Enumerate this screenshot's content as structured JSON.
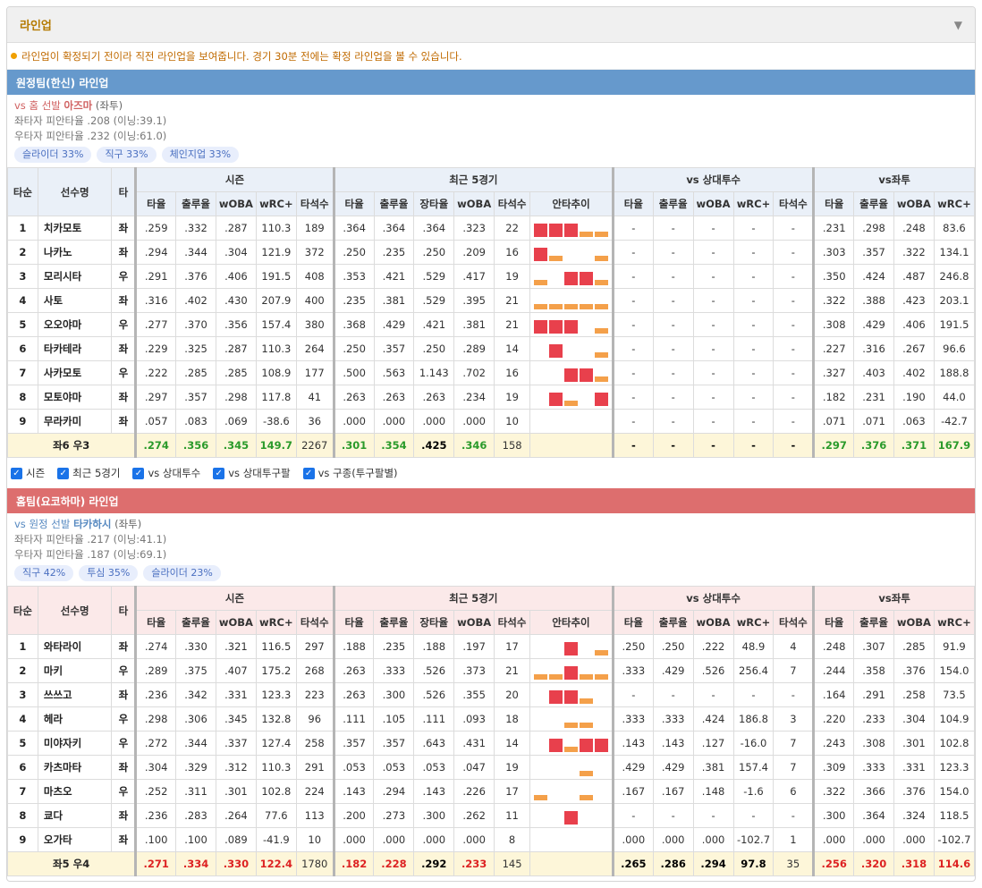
{
  "panel": {
    "title": "라인업",
    "toggle_icon": "▼"
  },
  "notice": "라인업이 확정되기 전이라 직전 라인업을 보여줍니다. 경기 30분 전에는 확정 라인업을 볼 수 있습니다.",
  "headers": {
    "order": "타순",
    "player": "선수명",
    "hand": "타",
    "groups": [
      "시즌",
      "최근 5경기",
      "vs 상대투수",
      "vs좌투"
    ],
    "season": [
      "타율",
      "출루율",
      "wOBA",
      "wRC+",
      "타석수"
    ],
    "recent": [
      "타율",
      "출루율",
      "장타율",
      "wOBA",
      "타석수",
      "안타추이"
    ],
    "vs_pitcher": [
      "타율",
      "출루율",
      "wOBA",
      "wRC+",
      "타석수"
    ],
    "vs_hand": [
      "타율",
      "출루율",
      "wOBA",
      "wRC+"
    ]
  },
  "away": {
    "bar_title": "원정팀(한신) 라인업",
    "pitcher_prefix": "vs 홈 선발 ",
    "pitcher_name": "아즈마",
    "pitcher_hand": " (좌투)",
    "line1": "좌타자 피안타율 .208 (이닝:39.1)",
    "line2": "우타자 피안타율 .232 (이닝:61.0)",
    "chips": [
      "슬라이더 33%",
      "직구 33%",
      "체인지업 33%"
    ],
    "rows": [
      {
        "order": "1",
        "name": "치카모토",
        "hand": "좌",
        "s": [
          ".259",
          ".332",
          ".287",
          "110.3",
          "189"
        ],
        "r": [
          ".364",
          ".364",
          ".364",
          ".323",
          "22"
        ],
        "trend": [
          "hi",
          "hi",
          "hi",
          "lo",
          "lo"
        ],
        "p": [
          "-",
          "-",
          "-",
          "-",
          "-"
        ],
        "h": [
          ".231",
          ".298",
          ".248",
          "83.6"
        ]
      },
      {
        "order": "2",
        "name": "나카노",
        "hand": "좌",
        "s": [
          ".294",
          ".344",
          ".304",
          "121.9",
          "372"
        ],
        "r": [
          ".250",
          ".235",
          ".250",
          ".209",
          "16"
        ],
        "trend": [
          "hi",
          "lo",
          "none",
          "none",
          "lo"
        ],
        "p": [
          "-",
          "-",
          "-",
          "-",
          "-"
        ],
        "h": [
          ".303",
          ".357",
          ".322",
          "134.1"
        ]
      },
      {
        "order": "3",
        "name": "모리시타",
        "hand": "우",
        "s": [
          ".291",
          ".376",
          ".406",
          "191.5",
          "408"
        ],
        "r": [
          ".353",
          ".421",
          ".529",
          ".417",
          "19"
        ],
        "trend": [
          "lo",
          "none",
          "hi",
          "hi",
          "lo"
        ],
        "p": [
          "-",
          "-",
          "-",
          "-",
          "-"
        ],
        "h": [
          ".350",
          ".424",
          ".487",
          "246.8"
        ]
      },
      {
        "order": "4",
        "name": "사토",
        "hand": "좌",
        "s": [
          ".316",
          ".402",
          ".430",
          "207.9",
          "400"
        ],
        "r": [
          ".235",
          ".381",
          ".529",
          ".395",
          "21"
        ],
        "trend": [
          "lo",
          "lo",
          "lo",
          "lo",
          "lo"
        ],
        "p": [
          "-",
          "-",
          "-",
          "-",
          "-"
        ],
        "h": [
          ".322",
          ".388",
          ".423",
          "203.1"
        ]
      },
      {
        "order": "5",
        "name": "오오야마",
        "hand": "우",
        "s": [
          ".277",
          ".370",
          ".356",
          "157.4",
          "380"
        ],
        "r": [
          ".368",
          ".429",
          ".421",
          ".381",
          "21"
        ],
        "trend": [
          "hi",
          "hi",
          "hi",
          "none",
          "lo"
        ],
        "p": [
          "-",
          "-",
          "-",
          "-",
          "-"
        ],
        "h": [
          ".308",
          ".429",
          ".406",
          "191.5"
        ]
      },
      {
        "order": "6",
        "name": "타카테라",
        "hand": "좌",
        "s": [
          ".229",
          ".325",
          ".287",
          "110.3",
          "264"
        ],
        "r": [
          ".250",
          ".357",
          ".250",
          ".289",
          "14"
        ],
        "trend": [
          "none",
          "hi",
          "none",
          "none",
          "lo"
        ],
        "p": [
          "-",
          "-",
          "-",
          "-",
          "-"
        ],
        "h": [
          ".227",
          ".316",
          ".267",
          "96.6"
        ]
      },
      {
        "order": "7",
        "name": "사카모토",
        "hand": "우",
        "s": [
          ".222",
          ".285",
          ".285",
          "108.9",
          "177"
        ],
        "r": [
          ".500",
          ".563",
          "1.143",
          ".702",
          "16"
        ],
        "trend": [
          "none",
          "none",
          "hi",
          "hi",
          "lo"
        ],
        "p": [
          "-",
          "-",
          "-",
          "-",
          "-"
        ],
        "h": [
          ".327",
          ".403",
          ".402",
          "188.8"
        ]
      },
      {
        "order": "8",
        "name": "모토야마",
        "hand": "좌",
        "s": [
          ".297",
          ".357",
          ".298",
          "117.8",
          "41"
        ],
        "r": [
          ".263",
          ".263",
          ".263",
          ".234",
          "19"
        ],
        "trend": [
          "none",
          "hi",
          "lo",
          "none",
          "hi"
        ],
        "p": [
          "-",
          "-",
          "-",
          "-",
          "-"
        ],
        "h": [
          ".182",
          ".231",
          ".190",
          "44.0"
        ]
      },
      {
        "order": "9",
        "name": "무라카미",
        "hand": "좌",
        "s": [
          ".057",
          ".083",
          ".069",
          "-38.6",
          "36"
        ],
        "r": [
          ".000",
          ".000",
          ".000",
          ".000",
          "10"
        ],
        "trend": [
          "none",
          "none",
          "none",
          "none",
          "none"
        ],
        "p": [
          "-",
          "-",
          "-",
          "-",
          "-"
        ],
        "h": [
          ".071",
          ".071",
          ".063",
          "-42.7"
        ]
      }
    ],
    "total": {
      "label": "좌6 우3",
      "s": [
        ".274",
        ".356",
        ".345",
        "149.7",
        "2267"
      ],
      "r": [
        ".301",
        ".354",
        ".425",
        ".346",
        "158"
      ],
      "p": [
        "-",
        "-",
        "-",
        "-",
        "-"
      ],
      "h": [
        ".297",
        ".376",
        ".371",
        "167.9"
      ]
    }
  },
  "checks": [
    "시즌",
    "최근 5경기",
    "vs 상대투수",
    "vs 상대투구팔",
    "vs 구종(투구팔별)"
  ],
  "home": {
    "bar_title": "홈팀(요코하마) 라인업",
    "pitcher_prefix": "vs 원정 선발 ",
    "pitcher_name": "타카하시",
    "pitcher_hand": " (좌투)",
    "line1": "좌타자 피안타율 .217 (이닝:41.1)",
    "line2": "우타자 피안타율 .187 (이닝:69.1)",
    "chips": [
      "직구 42%",
      "투심 35%",
      "슬라이더 23%"
    ],
    "rows": [
      {
        "order": "1",
        "name": "와타라이",
        "hand": "좌",
        "s": [
          ".274",
          ".330",
          ".321",
          "116.5",
          "297"
        ],
        "r": [
          ".188",
          ".235",
          ".188",
          ".197",
          "17"
        ],
        "trend": [
          "none",
          "none",
          "hi",
          "none",
          "lo"
        ],
        "p": [
          ".250",
          ".250",
          ".222",
          "48.9",
          "4"
        ],
        "h": [
          ".248",
          ".307",
          ".285",
          "91.9"
        ]
      },
      {
        "order": "2",
        "name": "마키",
        "hand": "우",
        "s": [
          ".289",
          ".375",
          ".407",
          "175.2",
          "268"
        ],
        "r": [
          ".263",
          ".333",
          ".526",
          ".373",
          "21"
        ],
        "trend": [
          "lo",
          "lo",
          "hi",
          "lo",
          "lo"
        ],
        "p": [
          ".333",
          ".429",
          ".526",
          "256.4",
          "7"
        ],
        "h": [
          ".244",
          ".358",
          ".376",
          "154.0"
        ]
      },
      {
        "order": "3",
        "name": "쓰쓰고",
        "hand": "좌",
        "s": [
          ".236",
          ".342",
          ".331",
          "123.3",
          "223"
        ],
        "r": [
          ".263",
          ".300",
          ".526",
          ".355",
          "20"
        ],
        "trend": [
          "none",
          "hi",
          "hi",
          "lo",
          "none"
        ],
        "p": [
          "-",
          "-",
          "-",
          "-",
          "-"
        ],
        "h": [
          ".164",
          ".291",
          ".258",
          "73.5"
        ]
      },
      {
        "order": "4",
        "name": "헤라",
        "hand": "우",
        "s": [
          ".298",
          ".306",
          ".345",
          "132.8",
          "96"
        ],
        "r": [
          ".111",
          ".105",
          ".111",
          ".093",
          "18"
        ],
        "trend": [
          "none",
          "none",
          "lo",
          "lo",
          "none"
        ],
        "p": [
          ".333",
          ".333",
          ".424",
          "186.8",
          "3"
        ],
        "h": [
          ".220",
          ".233",
          ".304",
          "104.9"
        ]
      },
      {
        "order": "5",
        "name": "미야자키",
        "hand": "우",
        "s": [
          ".272",
          ".344",
          ".337",
          "127.4",
          "258"
        ],
        "r": [
          ".357",
          ".357",
          ".643",
          ".431",
          "14"
        ],
        "trend": [
          "none",
          "hi",
          "lo",
          "hi",
          "hi"
        ],
        "p": [
          ".143",
          ".143",
          ".127",
          "-16.0",
          "7"
        ],
        "h": [
          ".243",
          ".308",
          ".301",
          "102.8"
        ]
      },
      {
        "order": "6",
        "name": "카츠마타",
        "hand": "좌",
        "s": [
          ".304",
          ".329",
          ".312",
          "110.3",
          "291"
        ],
        "r": [
          ".053",
          ".053",
          ".053",
          ".047",
          "19"
        ],
        "trend": [
          "none",
          "none",
          "none",
          "lo",
          "none"
        ],
        "p": [
          ".429",
          ".429",
          ".381",
          "157.4",
          "7"
        ],
        "h": [
          ".309",
          ".333",
          ".331",
          "123.3"
        ]
      },
      {
        "order": "7",
        "name": "마츠오",
        "hand": "우",
        "s": [
          ".252",
          ".311",
          ".301",
          "102.8",
          "224"
        ],
        "r": [
          ".143",
          ".294",
          ".143",
          ".226",
          "17"
        ],
        "trend": [
          "lo",
          "none",
          "none",
          "lo",
          "none"
        ],
        "p": [
          ".167",
          ".167",
          ".148",
          "-1.6",
          "6"
        ],
        "h": [
          ".322",
          ".366",
          ".376",
          "154.0"
        ]
      },
      {
        "order": "8",
        "name": "쿄다",
        "hand": "좌",
        "s": [
          ".236",
          ".283",
          ".264",
          "77.6",
          "113"
        ],
        "r": [
          ".200",
          ".273",
          ".300",
          ".262",
          "11"
        ],
        "trend": [
          "none",
          "none",
          "hi",
          "none",
          "none"
        ],
        "p": [
          "-",
          "-",
          "-",
          "-",
          "-"
        ],
        "h": [
          ".300",
          ".364",
          ".324",
          "118.5"
        ]
      },
      {
        "order": "9",
        "name": "오가타",
        "hand": "좌",
        "s": [
          ".100",
          ".100",
          ".089",
          "-41.9",
          "10"
        ],
        "r": [
          ".000",
          ".000",
          ".000",
          ".000",
          "8"
        ],
        "trend": [
          "none",
          "none",
          "none",
          "none",
          "none"
        ],
        "p": [
          ".000",
          ".000",
          ".000",
          "-102.7",
          "1"
        ],
        "h": [
          ".000",
          ".000",
          ".000",
          "-102.7"
        ]
      }
    ],
    "total": {
      "label": "좌5 우4",
      "s": [
        ".271",
        ".334",
        ".330",
        "122.4",
        "1780"
      ],
      "r": [
        ".182",
        ".228",
        ".292",
        ".233",
        "145"
      ],
      "p": [
        ".265",
        ".286",
        ".294",
        "97.8",
        "35"
      ],
      "h": [
        ".256",
        ".320",
        ".318",
        "114.6"
      ]
    }
  },
  "colors": {
    "away_bar": "#6699cc",
    "home_bar": "#dd6e6e",
    "trend_high": "#e8404c",
    "trend_low": "#f4a04a",
    "title": "#b57a00"
  }
}
